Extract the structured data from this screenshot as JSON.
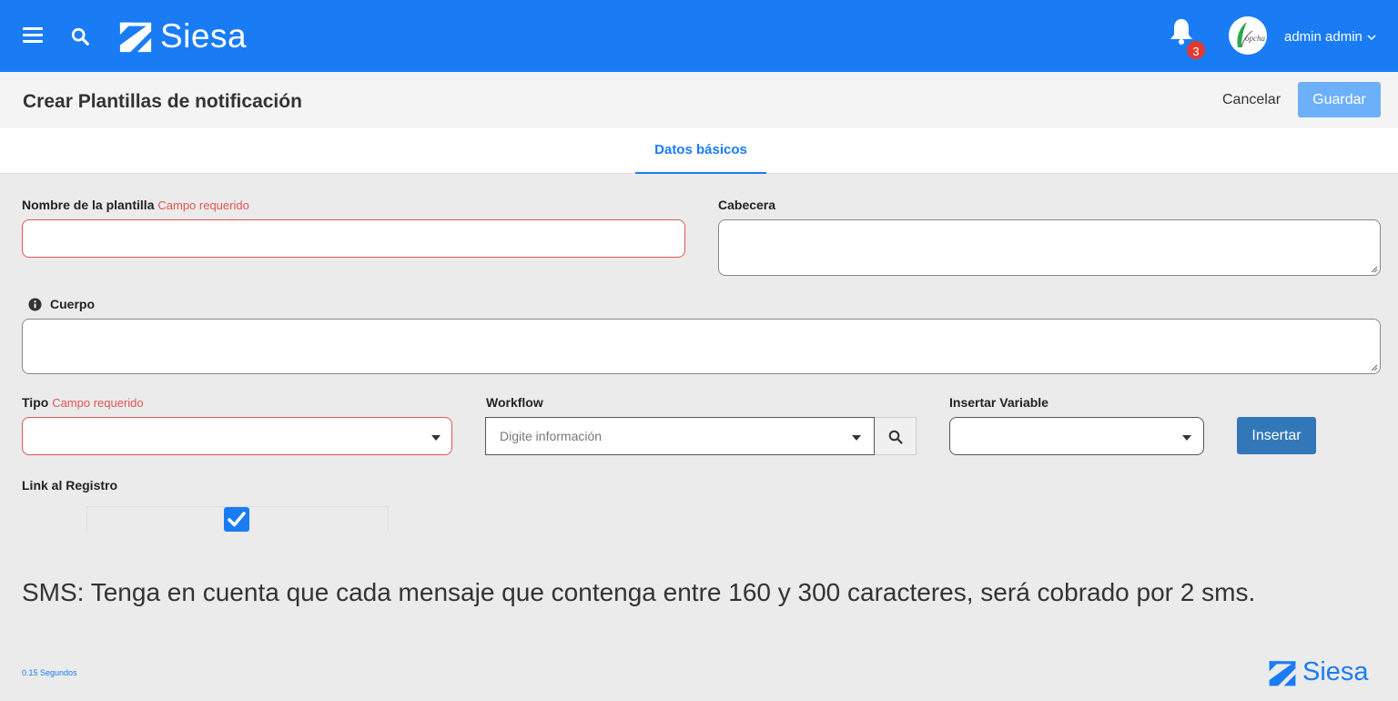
{
  "header": {
    "brand": "Siesa",
    "notifications_count": "3",
    "user_name": "admin admin",
    "avatar_text": "opcha"
  },
  "page": {
    "title": "Crear Plantillas de notificación",
    "cancel_label": "Cancelar",
    "save_label": "Guardar"
  },
  "tabs": [
    {
      "label": "Datos básicos",
      "active": true
    }
  ],
  "form": {
    "nombre": {
      "label": "Nombre de la plantilla",
      "required_text": "Campo requerido",
      "value": ""
    },
    "cabecera": {
      "label": "Cabecera",
      "value": ""
    },
    "cuerpo": {
      "label": "Cuerpo",
      "value": ""
    },
    "tipo": {
      "label": "Tipo",
      "required_text": "Campo requerido",
      "value": ""
    },
    "workflow": {
      "label": "Workflow",
      "placeholder": "Digite información"
    },
    "insertar_variable": {
      "label": "Insertar Variable",
      "value": ""
    },
    "insert_button": "Insertar",
    "link_registro": {
      "label": "Link al Registro",
      "checked": true
    }
  },
  "notice": "SMS: Tenga en cuenta que cada mensaje que contenga entre 160 y 300 caracteres, será cobrado por 2 sms.",
  "footer": {
    "timing": "0.15 Segundos",
    "brand": "Siesa"
  },
  "colors": {
    "primary": "#1a7cf5",
    "error": "#e15555",
    "insert_button": "#3277b8"
  }
}
